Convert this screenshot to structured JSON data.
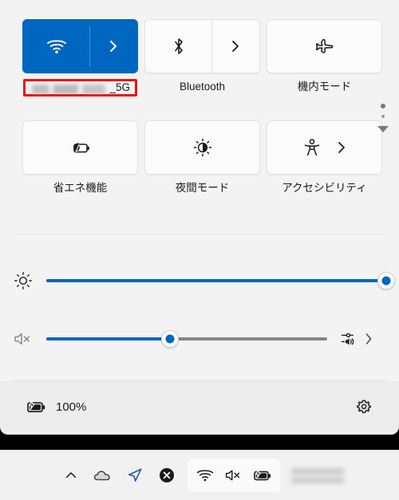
{
  "panel": {
    "name": "quick-settings",
    "colors": {
      "accent": "#0067c0",
      "panel_bg": "#f3f3f3",
      "footer_bg": "#ececec",
      "tile_off_bg": "#fbfbfb",
      "highlight_red": "#ee1111",
      "track_bg": "#868686"
    },
    "tiles": [
      {
        "id": "wifi",
        "label": "_5G",
        "label_redacted_prefix": true,
        "icon": "wifi-icon",
        "state": "on",
        "has_chevron": true,
        "chevron_style": "split",
        "highlighted": true
      },
      {
        "id": "bluetooth",
        "label": "Bluetooth",
        "icon": "bluetooth-icon",
        "state": "off",
        "has_chevron": true,
        "chevron_style": "split",
        "highlighted": false
      },
      {
        "id": "airplane-mode",
        "label": "機内モード",
        "icon": "airplane-icon",
        "state": "off",
        "has_chevron": false,
        "chevron_style": "none",
        "highlighted": false
      },
      {
        "id": "battery-saver",
        "label": "省エネ機能",
        "icon": "battery-leaf-icon",
        "state": "off",
        "has_chevron": false,
        "chevron_style": "none",
        "highlighted": false
      },
      {
        "id": "night-light",
        "label": "夜間モード",
        "icon": "night-light-sun-icon",
        "state": "off",
        "has_chevron": false,
        "chevron_style": "none",
        "highlighted": false
      },
      {
        "id": "accessibility",
        "label": "アクセシビリティ",
        "icon": "accessibility-person-icon",
        "state": "off",
        "has_chevron": true,
        "chevron_style": "inline",
        "highlighted": false
      }
    ],
    "pager": {
      "active_page": 1,
      "total_pages": 2,
      "next_icon": "chevron-down-triangle-icon"
    },
    "sliders": [
      {
        "id": "brightness",
        "icon": "brightness-sun-icon",
        "value_percent": 100
      },
      {
        "id": "volume",
        "icon": "speaker-muted-icon",
        "value_percent": 44,
        "extra_icon": "audio-output-select-icon",
        "extra_chevron": "chevron-right-icon"
      }
    ],
    "footer": {
      "battery_icon": "battery-charging-icon",
      "battery_percent": "100%",
      "settings_icon": "gear-icon"
    }
  },
  "taskbar": {
    "tray_items": [
      {
        "id": "show-hidden-icons",
        "icon": "chevron-up-icon"
      },
      {
        "id": "onedrive",
        "icon": "cloud-icon"
      },
      {
        "id": "location",
        "icon": "location-arrow-icon"
      },
      {
        "id": "notification-dismiss",
        "icon": "close-circle-icon"
      }
    ],
    "tray_group": [
      {
        "id": "tray-wifi",
        "icon": "wifi-icon"
      },
      {
        "id": "tray-volume",
        "icon": "speaker-muted-icon"
      },
      {
        "id": "tray-battery",
        "icon": "battery-charging-icon"
      }
    ],
    "clock": {
      "id": "clock",
      "redacted": true
    }
  }
}
